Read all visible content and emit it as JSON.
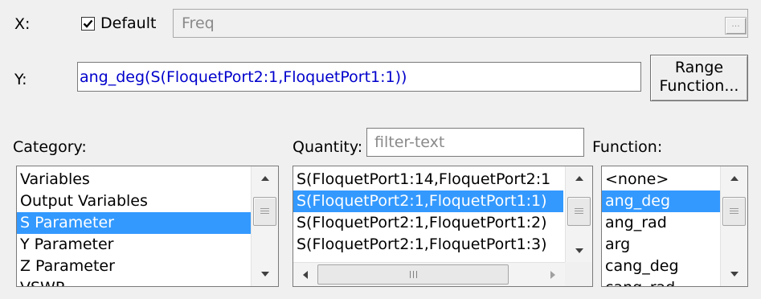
{
  "x_axis": {
    "label": "X:",
    "default_checked": true,
    "default_label": "Default",
    "value": "Freq",
    "browse_label": "..."
  },
  "y_axis": {
    "label": "Y:",
    "expression": "ang_deg(S(FloquetPort2:1,FloquetPort1:1))",
    "range_button_line1": "Range",
    "range_button_line2": "Function..."
  },
  "category": {
    "label": "Category:",
    "items": [
      "Variables",
      "Output Variables",
      "S Parameter",
      "Y Parameter",
      "Z Parameter",
      "VSWR"
    ],
    "selected": "S Parameter"
  },
  "quantity": {
    "label": "Quantity:",
    "filter_placeholder": "filter-text",
    "items": [
      "S(FloquetPort1:14,FloquetPort2:1",
      "S(FloquetPort2:1,FloquetPort1:1)",
      "S(FloquetPort2:1,FloquetPort1:2)",
      "S(FloquetPort2:1,FloquetPort1:3)"
    ],
    "selected": "S(FloquetPort2:1,FloquetPort1:1)"
  },
  "function": {
    "label": "Function:",
    "items": [
      "<none>",
      "ang_deg",
      "ang_rad",
      "arg",
      "cang_deg",
      "cang_rad"
    ],
    "selected": "ang_deg"
  },
  "colors": {
    "selection": "#3399ff",
    "expression_text": "#0000cc",
    "dialog_bg": "#f0f0f0"
  }
}
